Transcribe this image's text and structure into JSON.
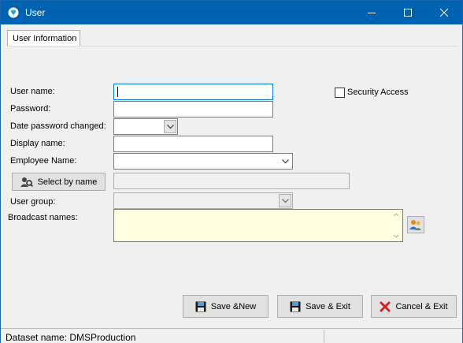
{
  "window": {
    "title": "User"
  },
  "tabs": [
    {
      "label": "User Information"
    }
  ],
  "form": {
    "user_name_label": "User name:",
    "password_label": "Password:",
    "date_password_changed_label": "Date password changed:",
    "display_name_label": "Display name:",
    "employee_name_label": "Employee Name:",
    "select_by_name_label": "Select by name",
    "user_group_label": "User group:",
    "broadcast_names_label": "Broadcast names:",
    "security_access_label": "Security Access",
    "user_name_value": "",
    "password_value": "",
    "display_name_value": "",
    "employee_name_value": "",
    "selected_name_value": "",
    "user_group_value": "",
    "broadcast_names_value": "",
    "security_access_checked": false
  },
  "buttons": {
    "save_new": "Save &New",
    "save_exit": "Save & Exit",
    "cancel_exit": "Cancel & Exit"
  },
  "statusbar": {
    "dataset": "Dataset name:  DMSProduction"
  },
  "icons": {
    "app": "diamond-app-icon",
    "minimize": "minimize-icon",
    "maximize": "maximize-icon",
    "close": "close-icon",
    "select_by_name": "people-search-icon",
    "broadcast": "people-lookup-icon",
    "save": "floppy-disk-icon",
    "cancel": "red-x-icon"
  },
  "colors": {
    "titlebar": "#0063b1",
    "memo_background": "#ffffe1",
    "cancel_x": "#d32020",
    "focus": "#0078d7"
  }
}
